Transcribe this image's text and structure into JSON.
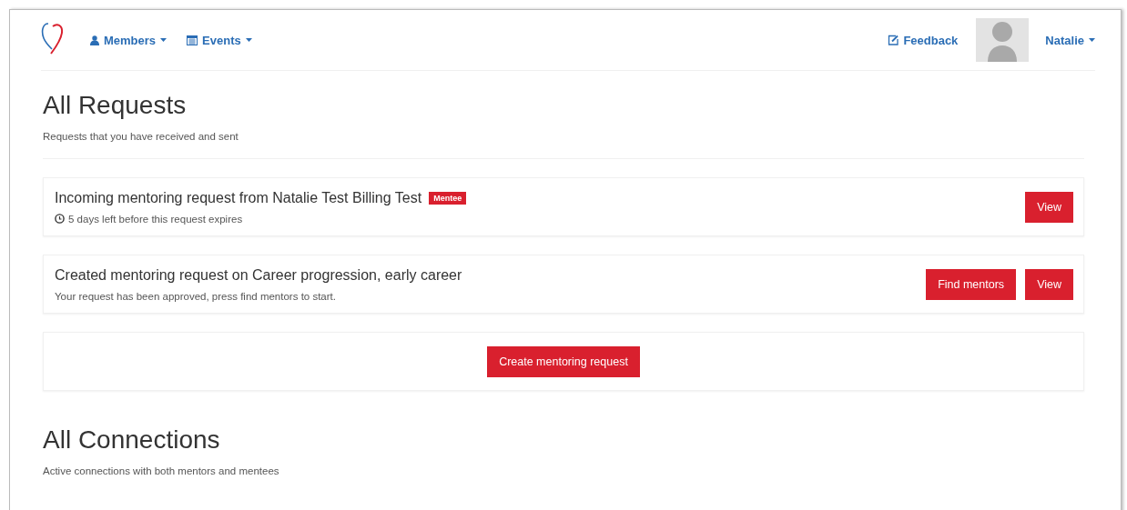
{
  "nav": {
    "menus": [
      {
        "kind": "members",
        "label": "Members"
      },
      {
        "kind": "events",
        "label": "Events"
      }
    ],
    "feedback": "Feedback",
    "user": "Natalie"
  },
  "requests_section": {
    "title": "All Requests",
    "subtitle": "Requests that you have received and sent",
    "requests": [
      {
        "kind": "incoming",
        "title": "Incoming mentoring request from Natalie Test Billing Test",
        "badge": "Mentee",
        "meta": "5 days left before this request expires",
        "buttons": [
          "View"
        ]
      },
      {
        "kind": "created",
        "title": "Created mentoring request on Career progression, early career",
        "meta": "Your request has been approved, press find mentors to start.",
        "buttons": [
          "Find mentors",
          "View"
        ]
      }
    ],
    "create_button": "Create mentoring request"
  },
  "connections_section": {
    "title": "All Connections",
    "subtitle": "Active connections with both mentors and mentees"
  }
}
